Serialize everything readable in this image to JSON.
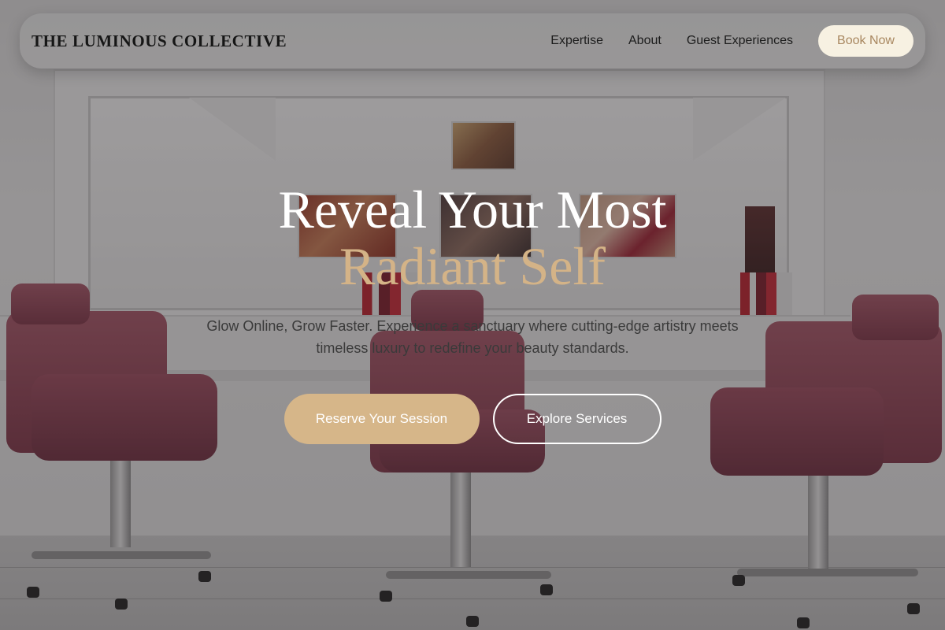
{
  "header": {
    "brand": "THE LUMINOUS COLLECTIVE",
    "nav": [
      {
        "label": "Expertise"
      },
      {
        "label": "About"
      },
      {
        "label": "Guest Experiences"
      }
    ],
    "book_label": "Book Now"
  },
  "hero": {
    "title_line1": "Reveal Your Most",
    "title_line2": "Radiant Self",
    "subtitle": "Glow Online, Grow Faster. Experience a sanctuary where cutting-edge artistry meets timeless luxury to redefine your beauty standards.",
    "primary_cta": "Reserve Your Session",
    "secondary_cta": "Explore Services"
  },
  "colors": {
    "accent_gold": "#d6b689",
    "title_accent": "#d4b387",
    "book_button_bg": "#f7f1e2",
    "book_button_text": "#a88760"
  }
}
